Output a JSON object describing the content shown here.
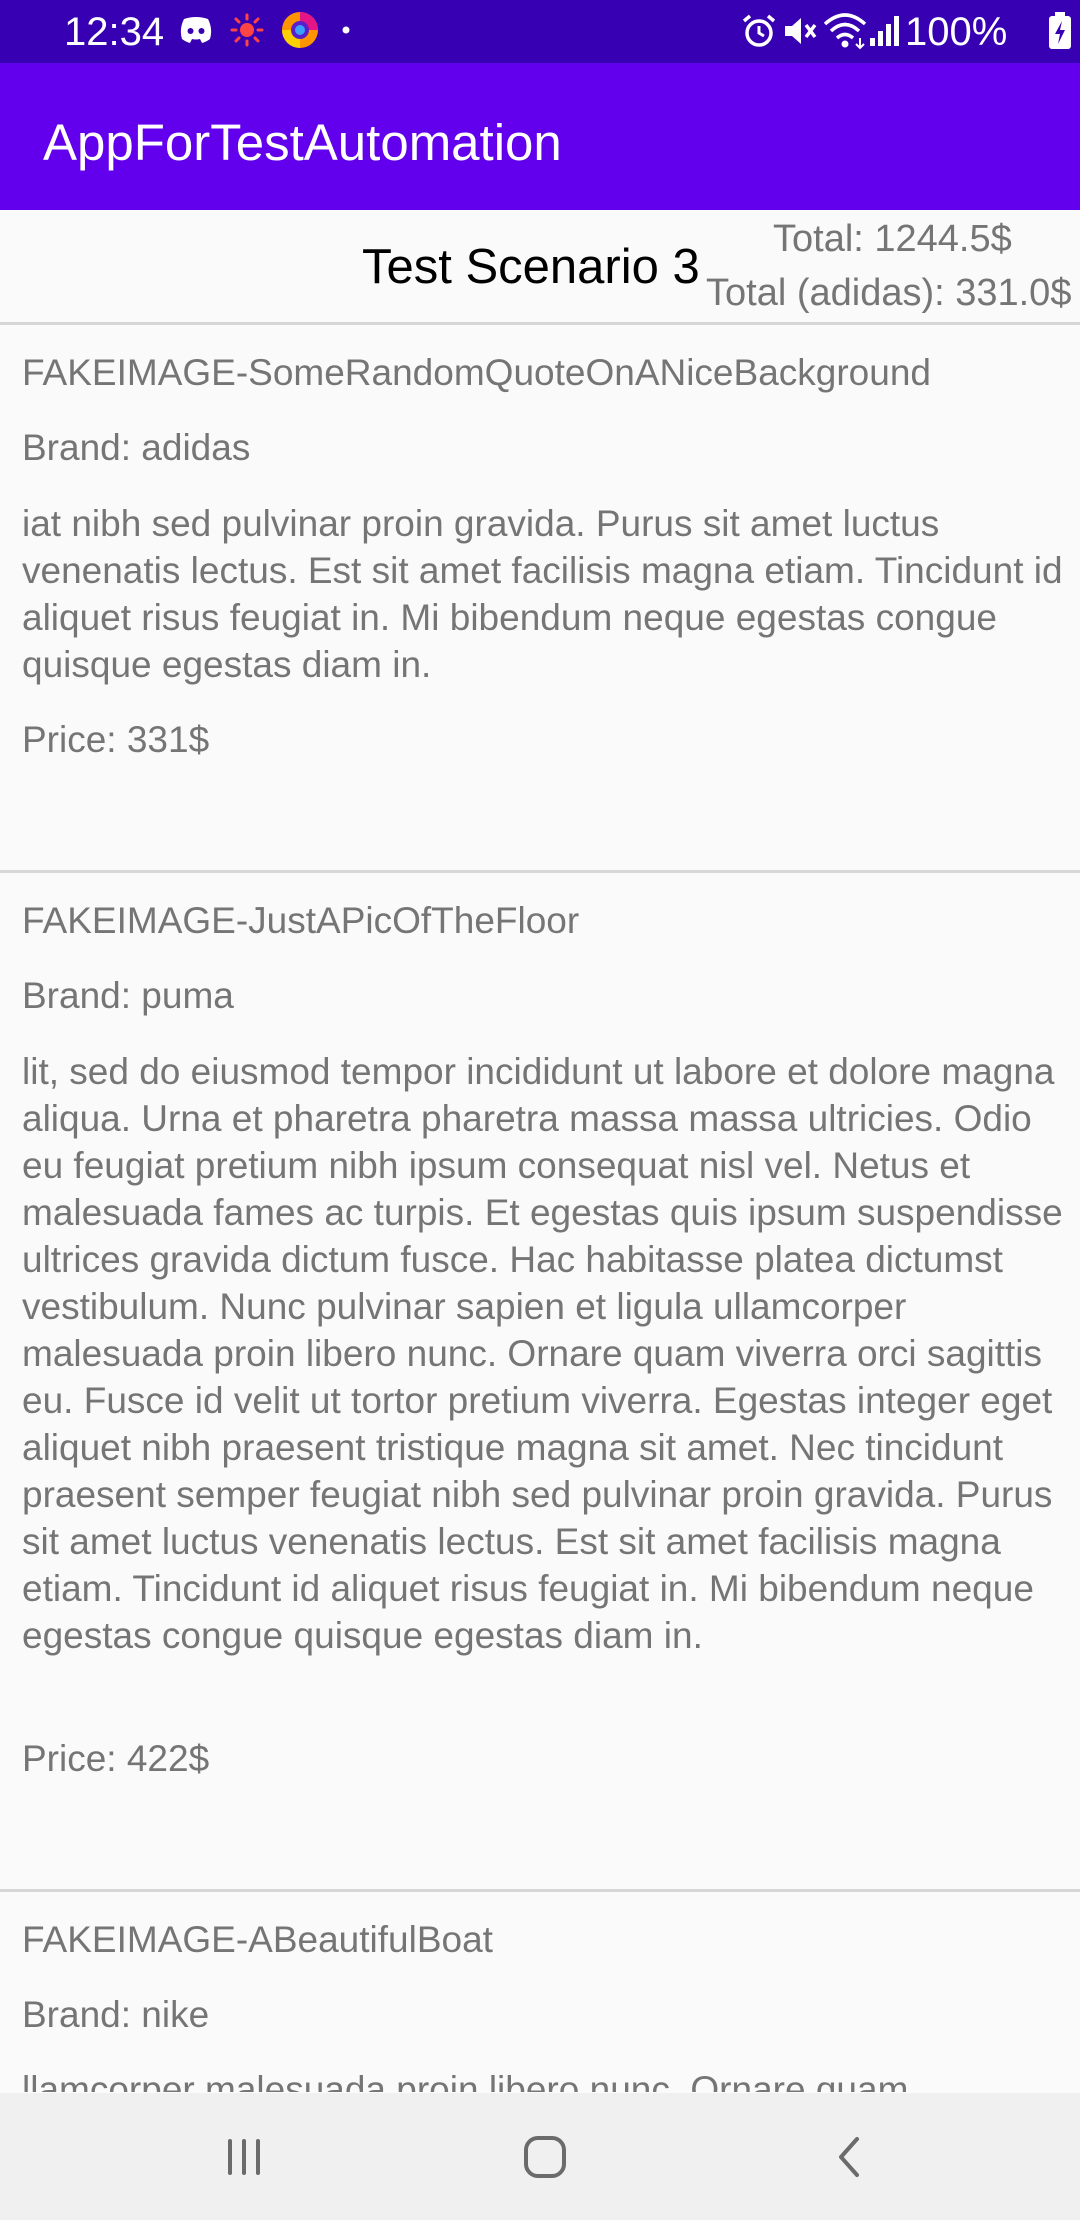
{
  "status_bar": {
    "time": "12:34",
    "battery": "100%",
    "left_icons": [
      "discord-icon",
      "sun-icon",
      "firefox-icon",
      "dot-icon"
    ],
    "right_icons": [
      "alarm-icon",
      "mute-icon",
      "wifi-icon",
      "signal-icon",
      "battery-icon"
    ]
  },
  "app_bar": {
    "title": "AppForTestAutomation"
  },
  "header": {
    "scenario_title": "Test Scenario 3",
    "total": "Total: 1244.5$",
    "total_brand": "Total (adidas): 331.0$"
  },
  "items": [
    {
      "image": "FAKEIMAGE-SomeRandomQuoteOnANiceBackground",
      "brand": "Brand: adidas",
      "description": "iat nibh sed pulvinar proin gravida. Purus sit amet luctus venenatis lectus. Est sit amet facilisis magna etiam. Tincidunt id aliquet risus feugiat in. Mi bibendum neque egestas congue quisque egestas diam in.",
      "price": "Price: 331$"
    },
    {
      "image": "FAKEIMAGE-JustAPicOfTheFloor",
      "brand": "Brand: puma",
      "description": "lit, sed do eiusmod tempor incididunt ut labore et dolore magna aliqua. Urna et pharetra pharetra massa massa ultricies. Odio eu feugiat pretium nibh ipsum consequat nisl vel. Netus et malesuada fames ac turpis. Et egestas quis ipsum suspendisse ultrices gravida dictum fusce. Hac habitasse platea dictumst vestibulum. Nunc pulvinar sapien et ligula ullamcorper malesuada proin libero nunc. Ornare quam viverra orci sagittis eu. Fusce id velit ut tortor pretium viverra. Egestas integer eget aliquet nibh praesent tristique magna sit amet. Nec tincidunt praesent semper feugiat nibh sed pulvinar proin gravida. Purus sit amet luctus venenatis lectus. Est sit amet facilisis magna etiam. Tincidunt id aliquet risus feugiat in. Mi bibendum neque egestas congue quisque egestas diam in.",
      "price": "Price: 422$"
    },
    {
      "image": "FAKEIMAGE-ABeautifulBoat",
      "brand": "Brand: nike",
      "description_partial": "llamcorper malesuada proin libero nunc. Ornare quam"
    }
  ],
  "nav_bar": {
    "buttons": [
      "recent-apps-icon",
      "home-icon",
      "back-icon"
    ]
  },
  "colors": {
    "status_bar": "#3700b3",
    "app_bar": "#6200ee",
    "background": "#fafafa",
    "secondary_text": "#757575",
    "divider": "#d6d6d6",
    "nav_bar": "#f0f0f0"
  }
}
